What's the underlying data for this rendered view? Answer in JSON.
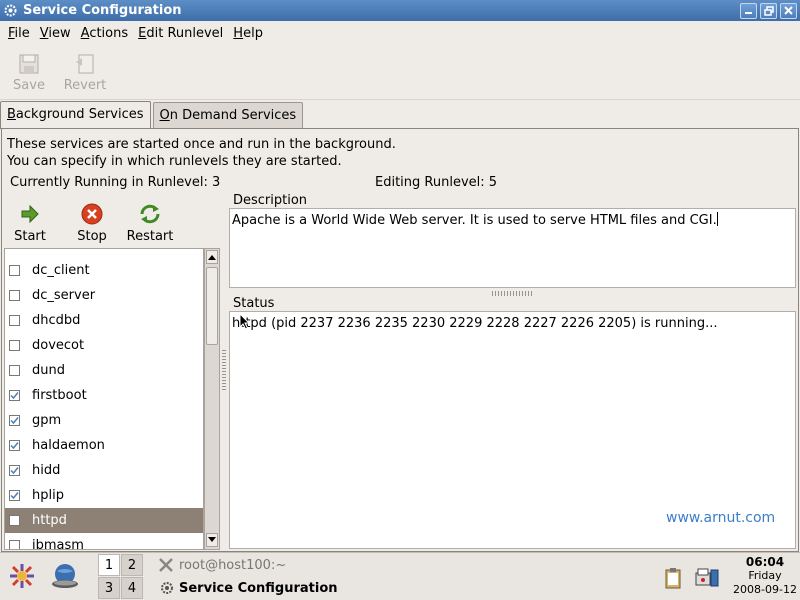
{
  "window": {
    "title": "Service Configuration",
    "icon": "gear-icon"
  },
  "menubar": {
    "items": [
      {
        "pre": "",
        "u": "F",
        "post": "ile"
      },
      {
        "pre": "",
        "u": "V",
        "post": "iew"
      },
      {
        "pre": "",
        "u": "A",
        "post": "ctions"
      },
      {
        "pre": "",
        "u": "E",
        "post": "dit Runlevel"
      },
      {
        "pre": "",
        "u": "H",
        "post": "elp"
      }
    ]
  },
  "toolbar": {
    "save_label": "Save",
    "revert_label": "Revert"
  },
  "tabs": [
    {
      "pre": "",
      "u": "B",
      "post": "ackground Services"
    },
    {
      "pre": "",
      "u": "O",
      "post": "n Demand Services"
    }
  ],
  "info": {
    "line1": "These services are started once and run in the background.",
    "line2": "You can specify in which runlevels they are started.",
    "current_runlevel": "Currently Running in Runlevel: 3",
    "editing_runlevel": "Editing Runlevel: 5"
  },
  "actions": {
    "start": "Start",
    "stop": "Stop",
    "restart": "Restart"
  },
  "services": [
    {
      "name": "dc_client",
      "checked": false
    },
    {
      "name": "dc_server",
      "checked": false
    },
    {
      "name": "dhcdbd",
      "checked": false
    },
    {
      "name": "dovecot",
      "checked": false
    },
    {
      "name": "dund",
      "checked": false
    },
    {
      "name": "firstboot",
      "checked": true
    },
    {
      "name": "gpm",
      "checked": true
    },
    {
      "name": "haldaemon",
      "checked": true
    },
    {
      "name": "hidd",
      "checked": true
    },
    {
      "name": "hplip",
      "checked": true
    },
    {
      "name": "httpd",
      "checked": false,
      "selected": true
    },
    {
      "name": "ibmasm",
      "checked": false
    }
  ],
  "description": {
    "label": "Description",
    "text": "Apache is a World Wide Web server.  It is used to serve HTML files and CGI."
  },
  "status": {
    "label": "Status",
    "text": "httpd (pid 2237 2236 2235 2230 2229 2228 2227 2226 2205) is running..."
  },
  "watermark": "www.arnut.com",
  "taskbar": {
    "workspaces": [
      "1",
      "2",
      "3",
      "4"
    ],
    "tasks": [
      {
        "label": "root@host100:~",
        "icon": "terminal-x-icon"
      },
      {
        "label": "Service Configuration",
        "icon": "gear-icon"
      }
    ],
    "clock": {
      "time": "06:04",
      "day": "Friday",
      "date": "2008-09-12"
    }
  },
  "colors": {
    "titlebar": "#3d6ea9",
    "selection": "#8d8175",
    "watermark": "#3c7ec9"
  }
}
